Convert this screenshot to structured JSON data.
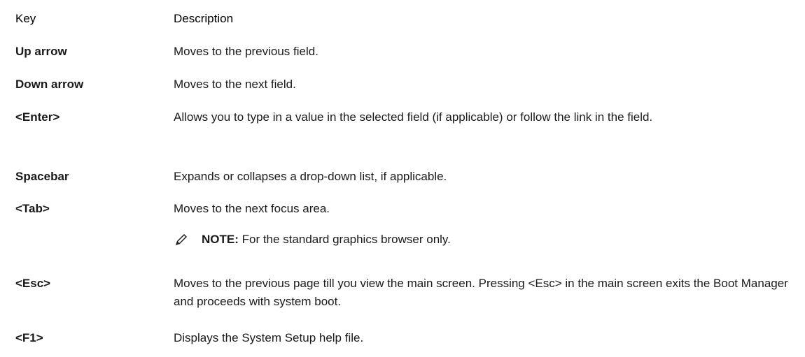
{
  "table": {
    "header": {
      "key": "Key",
      "description": "Description"
    },
    "rows": [
      {
        "key": "Up arrow",
        "description": "Moves to the previous field."
      },
      {
        "key": "Down arrow",
        "description": "Moves to the next field."
      },
      {
        "key": "<Enter>",
        "description": "Allows you to type in a value in the selected field (if applicable) or follow the link in the field."
      },
      {
        "key": "Spacebar",
        "description": "Expands or collapses a drop-down list, if applicable."
      },
      {
        "key": "<Tab>",
        "description": "Moves to the next focus area."
      },
      {
        "key": "<Esc>",
        "description": "Moves to the previous page till you view the main screen. Pressing <Esc> in the main screen exits the Boot Manager and proceeds with system boot."
      },
      {
        "key": "<F1>",
        "description": "Displays the System Setup help file."
      }
    ],
    "note": {
      "label": "NOTE:",
      "text": " For the standard graphics browser only.",
      "icon": "pencil-note-icon"
    }
  }
}
